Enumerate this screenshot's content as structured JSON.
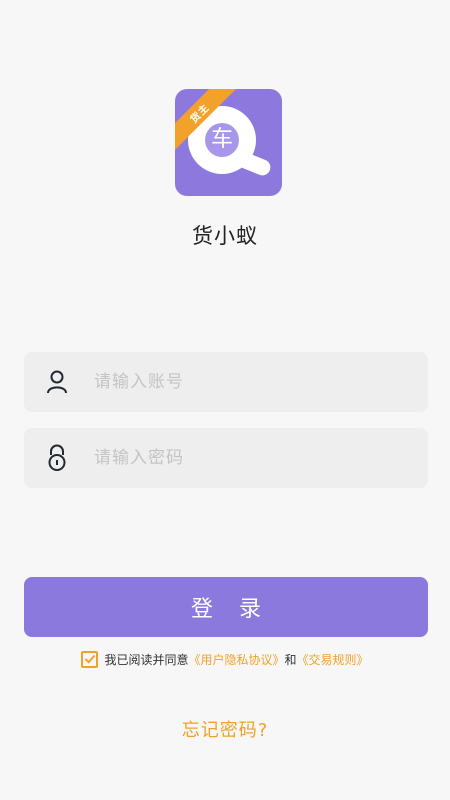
{
  "app": {
    "name": "货小蚁",
    "logo_badge": "货主",
    "logo_glyph": "车"
  },
  "account": {
    "placeholder": "请输入账号",
    "value": ""
  },
  "password": {
    "placeholder": "请输入密码",
    "value": ""
  },
  "login": {
    "label": "登录"
  },
  "agreement": {
    "checked": true,
    "prefix": "我已阅读并同意",
    "privacy_link": "《用户隐私协议》",
    "conjunction": "和",
    "rules_link": "《交易规则》"
  },
  "forgot": {
    "label": "忘记密码?"
  },
  "colors": {
    "primary": "#8b79dd",
    "accent": "#f0a228",
    "background": "#f7f7f7",
    "input_bg": "#eeeeee"
  },
  "icons": {
    "account": "user-icon",
    "password": "lock-icon",
    "agreement": "checkmark-icon"
  }
}
